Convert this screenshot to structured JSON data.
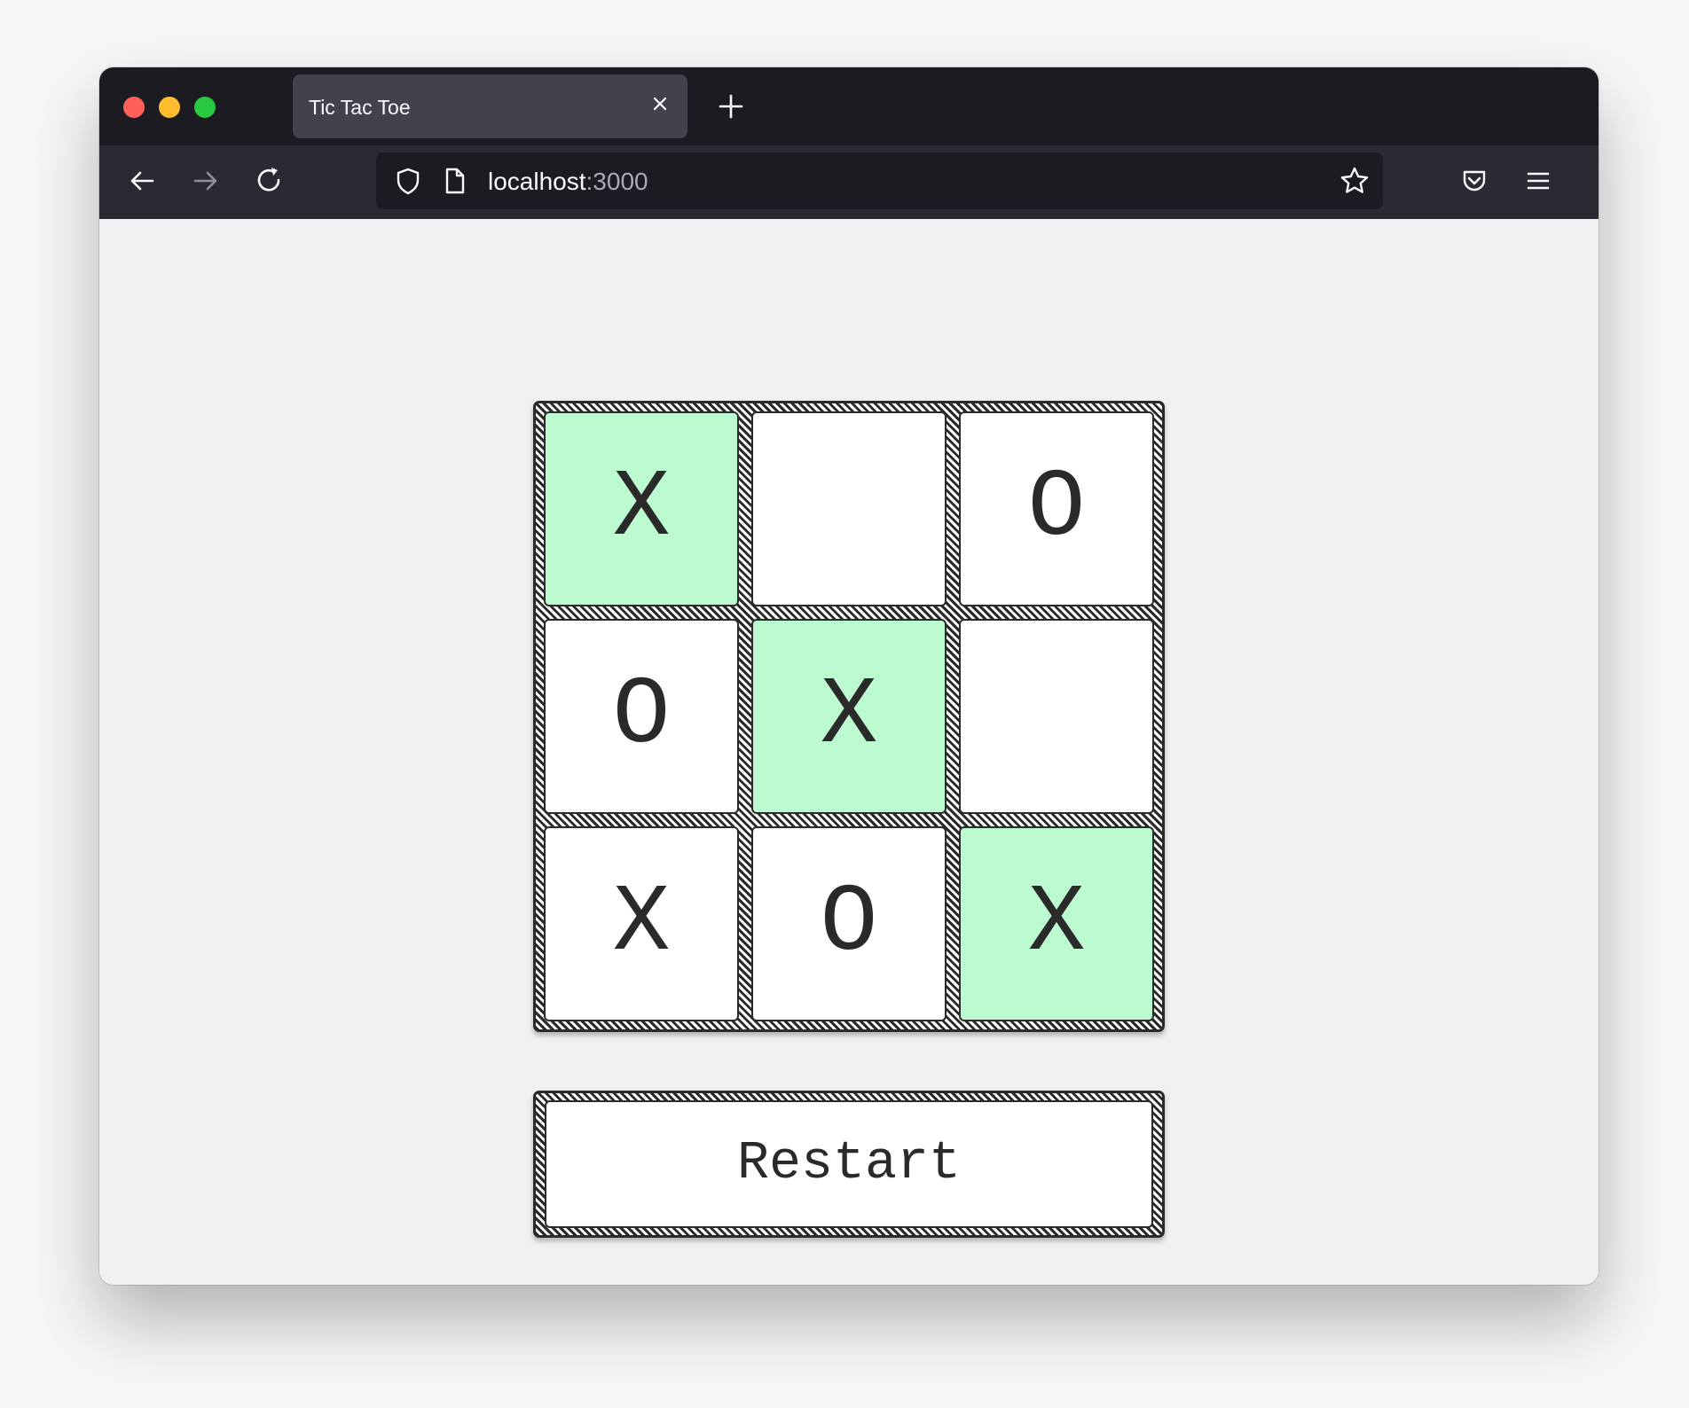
{
  "browser": {
    "tab_title": "Tic Tac Toe",
    "url_host": "localhost",
    "url_port": ":3000"
  },
  "game": {
    "cells": [
      "X",
      "",
      "O",
      "O",
      "X",
      "",
      "X",
      "O",
      "X"
    ],
    "winning_cells": [
      0,
      4,
      8
    ],
    "restart_label": "Restart"
  },
  "colors": {
    "win_highlight": "#bbfbcf",
    "cell_background": "#ffffff",
    "page_background": "#f0f0f0",
    "ink": "#2a2a2a"
  },
  "icons": {
    "back": "arrow-left-icon",
    "forward": "arrow-right-icon",
    "reload": "reload-icon",
    "shield": "shield-icon",
    "page": "page-icon",
    "bookmark": "star-icon",
    "pocket": "pocket-icon",
    "menu": "hamburger-menu-icon",
    "tab_close": "close-icon",
    "new_tab": "plus-icon"
  }
}
